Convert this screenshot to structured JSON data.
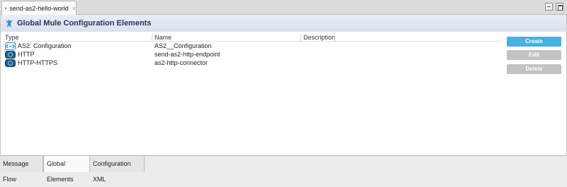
{
  "editor_tab": {
    "label": "send-as2-hello-world",
    "close_icon": "×"
  },
  "header": {
    "title": "Global Mule Configuration Elements"
  },
  "table": {
    "columns": [
      "Type",
      "Name",
      "Description"
    ],
    "rows": [
      {
        "type": "AS2: Configuration",
        "name": "AS2__Configuration",
        "description": "",
        "icon": "as2-config-icon"
      },
      {
        "type": "HTTP",
        "name": "send-as2-http-endpoint",
        "description": "",
        "icon": "http-icon"
      },
      {
        "type": "HTTP-HTTPS",
        "name": "as2-http-connector",
        "description": "",
        "icon": "http-icon"
      }
    ]
  },
  "buttons": {
    "create": "Create",
    "edit": "Edit",
    "delete": "Delete"
  },
  "bottom_tabs": [
    "Message Flow",
    "Global Elements",
    "Configuration XML"
  ],
  "colors": {
    "create_button": "#4ab0de",
    "disabled_button": "#c2c2c2",
    "header_title": "#26374d"
  }
}
